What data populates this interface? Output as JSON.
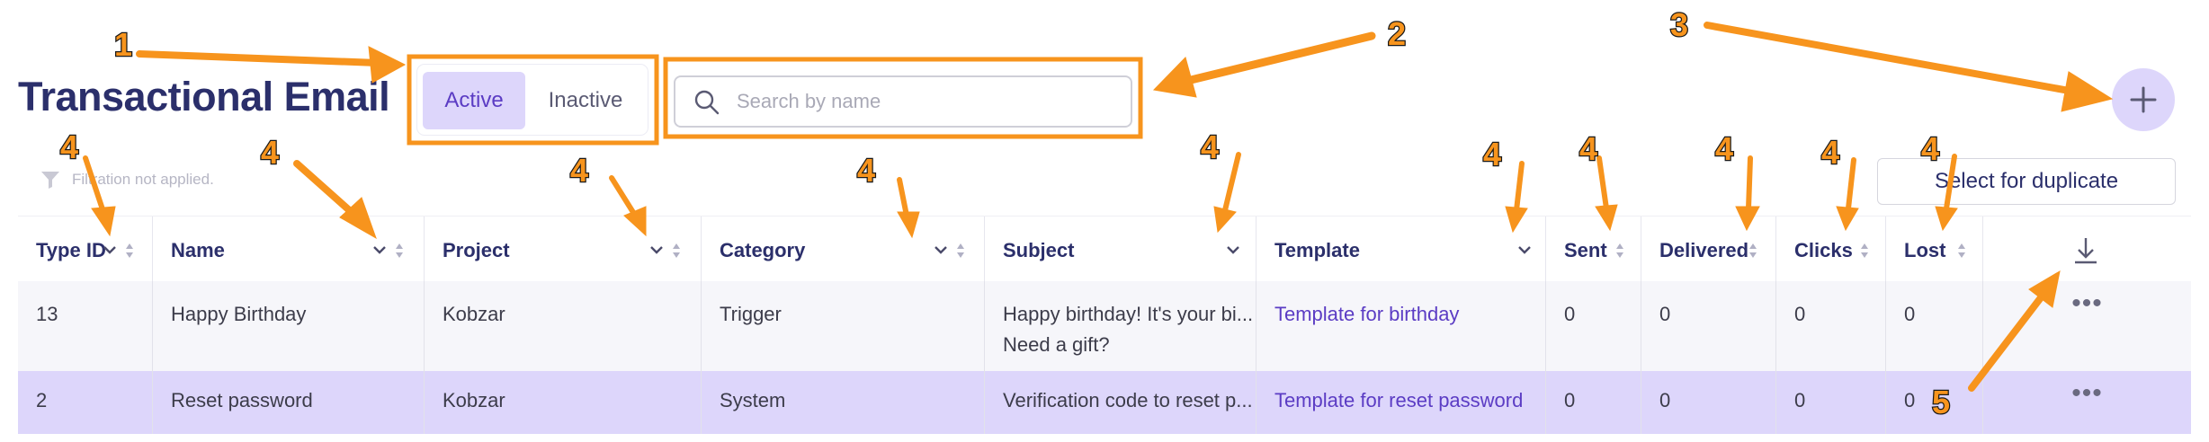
{
  "page": {
    "title": "Transactional Email"
  },
  "status_toggle": {
    "active": "Active",
    "inactive": "Inactive"
  },
  "search": {
    "placeholder": "Search by name"
  },
  "filter_note": "Filtration not applied.",
  "duplicate_button": "Select for duplicate",
  "table": {
    "headers": [
      "Type ID",
      "Name",
      "Project",
      "Category",
      "Subject",
      "Template",
      "Sent",
      "Delivered",
      "Clicks",
      "Lost"
    ],
    "rows": [
      {
        "type_id": "13",
        "name": "Happy Birthday",
        "project": "Kobzar",
        "category": "Trigger",
        "subject_line1": "Happy birthday! It's your bi...",
        "subject_line2": "Need a gift?",
        "template": "Template for birthday",
        "sent": "0",
        "delivered": "0",
        "clicks": "0",
        "lost": "0",
        "more": "•••"
      },
      {
        "type_id": "2",
        "name": "Reset password",
        "project": "Kobzar",
        "category": "System",
        "subject_line1": "Verification code to reset p...",
        "subject_line2": "",
        "template": "Template for reset password",
        "sent": "0",
        "delivered": "0",
        "clicks": "0",
        "lost": "0",
        "more": "•••"
      }
    ]
  },
  "annotations": [
    "1",
    "2",
    "3",
    "4",
    "4",
    "4",
    "4",
    "4",
    "4",
    "4",
    "4",
    "4",
    "4",
    "5"
  ],
  "colors": {
    "accent": "#5b3cc4",
    "title": "#2b2f6b",
    "highlight": "#ddd6fb",
    "arrow": "#f7941d"
  }
}
